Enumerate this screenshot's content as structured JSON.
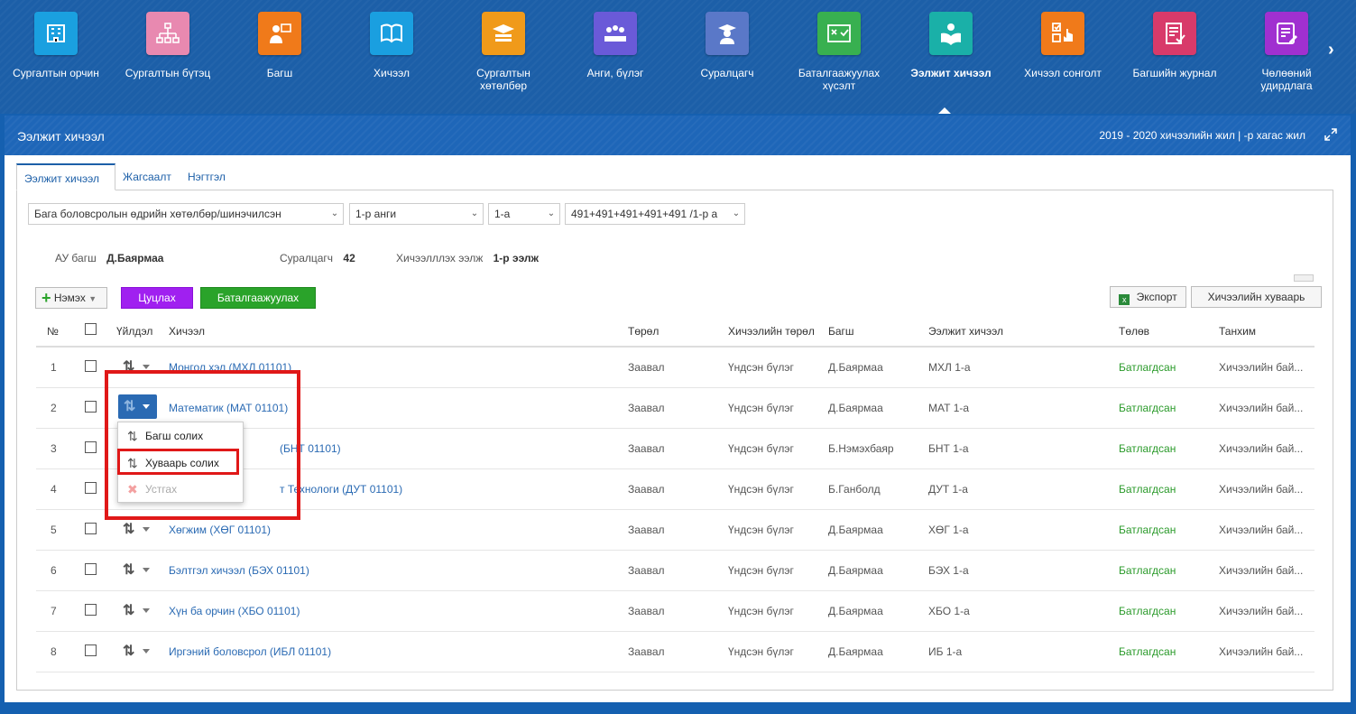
{
  "nav": {
    "items": [
      {
        "label": "Сургалтын орчин",
        "icon": "building-icon",
        "color": "#1aa0e0"
      },
      {
        "label": "Сургалтын бүтэц",
        "icon": "org-chart-icon",
        "color": "#e889b0"
      },
      {
        "label": "Багш",
        "icon": "teacher-icon",
        "color": "#f07a1a"
      },
      {
        "label": "Хичээл",
        "icon": "book-icon",
        "color": "#1a9fe0"
      },
      {
        "label": "Сургалтын хөтөлбөр",
        "icon": "curriculum-icon",
        "color": "#f09a1a"
      },
      {
        "label": "Анги, бүлэг",
        "icon": "class-icon",
        "color": "#6a5ad8"
      },
      {
        "label": "Суралцагч",
        "icon": "student-icon",
        "color": "#5a78c8"
      },
      {
        "label": "Баталгаажуулах хүсэлт",
        "icon": "approval-icon",
        "color": "#38b050"
      },
      {
        "label": "Ээлжит хичээл",
        "icon": "reading-icon",
        "color": "#1ab0a8"
      },
      {
        "label": "Хичээл сонголт",
        "icon": "selection-icon",
        "color": "#f07a1a"
      },
      {
        "label": "Багшийн журнал",
        "icon": "journal-icon",
        "color": "#d83a6a"
      },
      {
        "label": "Чөлөөний удирдлага",
        "icon": "leave-icon",
        "color": "#a030d0"
      }
    ],
    "active_index": 8
  },
  "panel": {
    "title": "Ээлжит хичээл",
    "year": "2019 - 2020 хичээлийн жил | -р хагас жил"
  },
  "tabs": [
    "Ээлжит хичээл",
    "Жагсаалт",
    "Нэгтгэл"
  ],
  "filters": {
    "program": "Бага боловсролын өдрийн хөтөлбөр/шинэчилсэн",
    "grade": "1-р анги",
    "class": "1-а",
    "plan": "491+491+491+491+491 /1-р а"
  },
  "info": {
    "teacher_label": "АУ багш",
    "teacher_value": "Д.Баярмаа",
    "students_label": "Суралцагч",
    "students_value": "42",
    "term_label": "Хичээлллэх ээлж",
    "term_value": "1-р ээлж"
  },
  "toolbar": {
    "add": "Нэмэх",
    "cancel": "Цуцлах",
    "confirm": "Баталгаажуулах",
    "export": "Экспорт",
    "schedule": "Хичээлийн хуваарь"
  },
  "table": {
    "headers": {
      "num": "№",
      "action": "Үйлдэл",
      "lesson": "Хичээл",
      "type": "Төрөл",
      "lesson_type": "Хичээлийн төрөл",
      "teacher": "Багш",
      "shift": "Ээлжит хичээл",
      "status": "Төлөв",
      "room": "Танхим"
    },
    "rows": [
      {
        "num": "1",
        "lesson": "Монгол хэл (МХЛ 01101)",
        "type": "Заавал",
        "lesson_type": "Үндсэн бүлэг",
        "teacher": "Д.Баярмаа",
        "shift": "МХЛ 1-а",
        "status": "Батлагдсан",
        "room": "Хичээлийн бай..."
      },
      {
        "num": "2",
        "lesson": "Математик (МАТ 01101)",
        "type": "Заавал",
        "lesson_type": "Үндсэн бүлэг",
        "teacher": "Д.Баярмаа",
        "shift": "МАТ 1-а",
        "status": "Батлагдсан",
        "room": "Хичээлийн бай..."
      },
      {
        "num": "3",
        "lesson": "(БНТ 01101)",
        "type": "Заавал",
        "lesson_type": "Үндсэн бүлэг",
        "teacher": "Б.Нэмэхбаяр",
        "shift": "БНТ 1-а",
        "status": "Батлагдсан",
        "room": "Хичээлийн бай..."
      },
      {
        "num": "4",
        "lesson": "т Технологи (ДУТ 01101)",
        "type": "Заавал",
        "lesson_type": "Үндсэн бүлэг",
        "teacher": "Б.Ганболд",
        "shift": "ДУТ 1-а",
        "status": "Батлагдсан",
        "room": "Хичээлийн бай..."
      },
      {
        "num": "5",
        "lesson": "Хөгжим (ХӨГ 01101)",
        "type": "Заавал",
        "lesson_type": "Үндсэн бүлэг",
        "teacher": "Д.Баярмаа",
        "shift": "ХӨГ 1-а",
        "status": "Батлагдсан",
        "room": "Хичээлийн бай..."
      },
      {
        "num": "6",
        "lesson": "Бэлтгэл хичээл (БЭХ 01101)",
        "type": "Заавал",
        "lesson_type": "Үндсэн бүлэг",
        "teacher": "Д.Баярмаа",
        "shift": "БЭХ 1-а",
        "status": "Батлагдсан",
        "room": "Хичээлийн бай..."
      },
      {
        "num": "7",
        "lesson": "Хүн ба орчин (ХБО 01101)",
        "type": "Заавал",
        "lesson_type": "Үндсэн бүлэг",
        "teacher": "Д.Баярмаа",
        "shift": "ХБО 1-а",
        "status": "Батлагдсан",
        "room": "Хичээлийн бай..."
      },
      {
        "num": "8",
        "lesson": "Иргэний боловсрол (ИБЛ 01101)",
        "type": "Заавал",
        "lesson_type": "Үндсэн бүлэг",
        "teacher": "Д.Баярмаа",
        "shift": "ИБ 1-а",
        "status": "Батлагдсан",
        "room": "Хичээлийн бай..."
      }
    ]
  },
  "dropdown": {
    "change_teacher": "Багш солих",
    "change_schedule": "Хуваарь солих",
    "remove": "Устгах"
  },
  "colors": {
    "nav_bg": "#1c5fa8",
    "link": "#2a6ab3",
    "status_ok": "#2a9a2a",
    "highlight": "#e01818"
  }
}
